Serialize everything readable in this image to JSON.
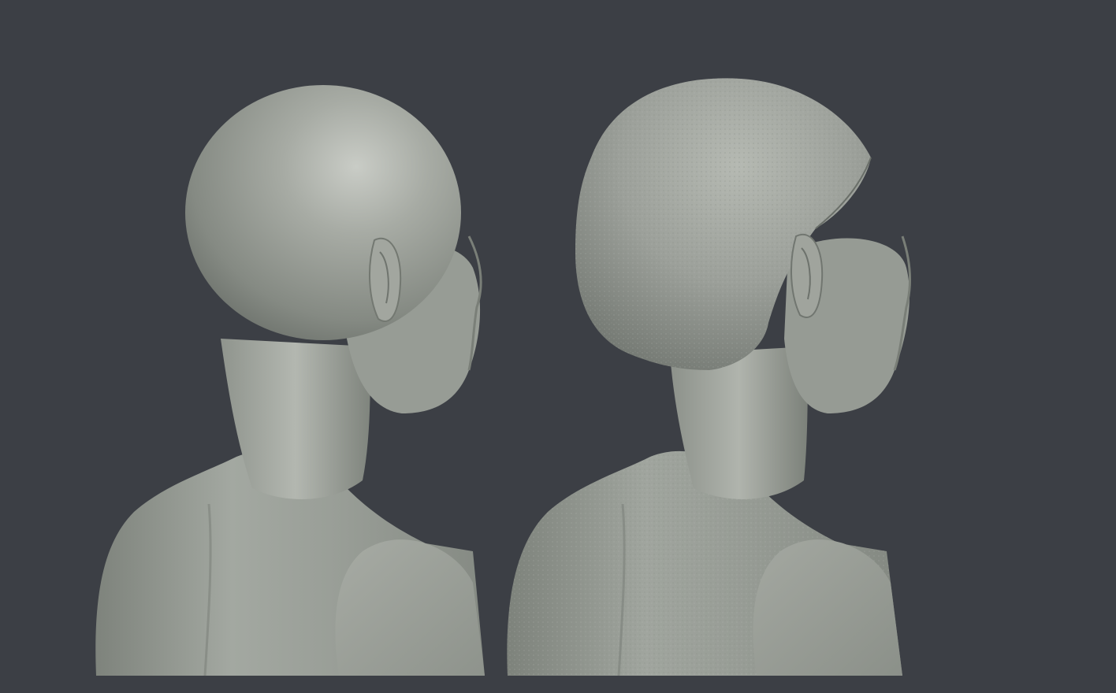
{
  "scene": {
    "background_color": "#3c3f45",
    "clay_color": "#9ea39b",
    "clay_highlight": "#c4c8c1",
    "clay_shadow": "#6f746e",
    "models": [
      {
        "view": "back-three-quarter",
        "variant": "smooth-bald"
      },
      {
        "view": "back-three-quarter",
        "variant": "hair-cap"
      }
    ]
  }
}
